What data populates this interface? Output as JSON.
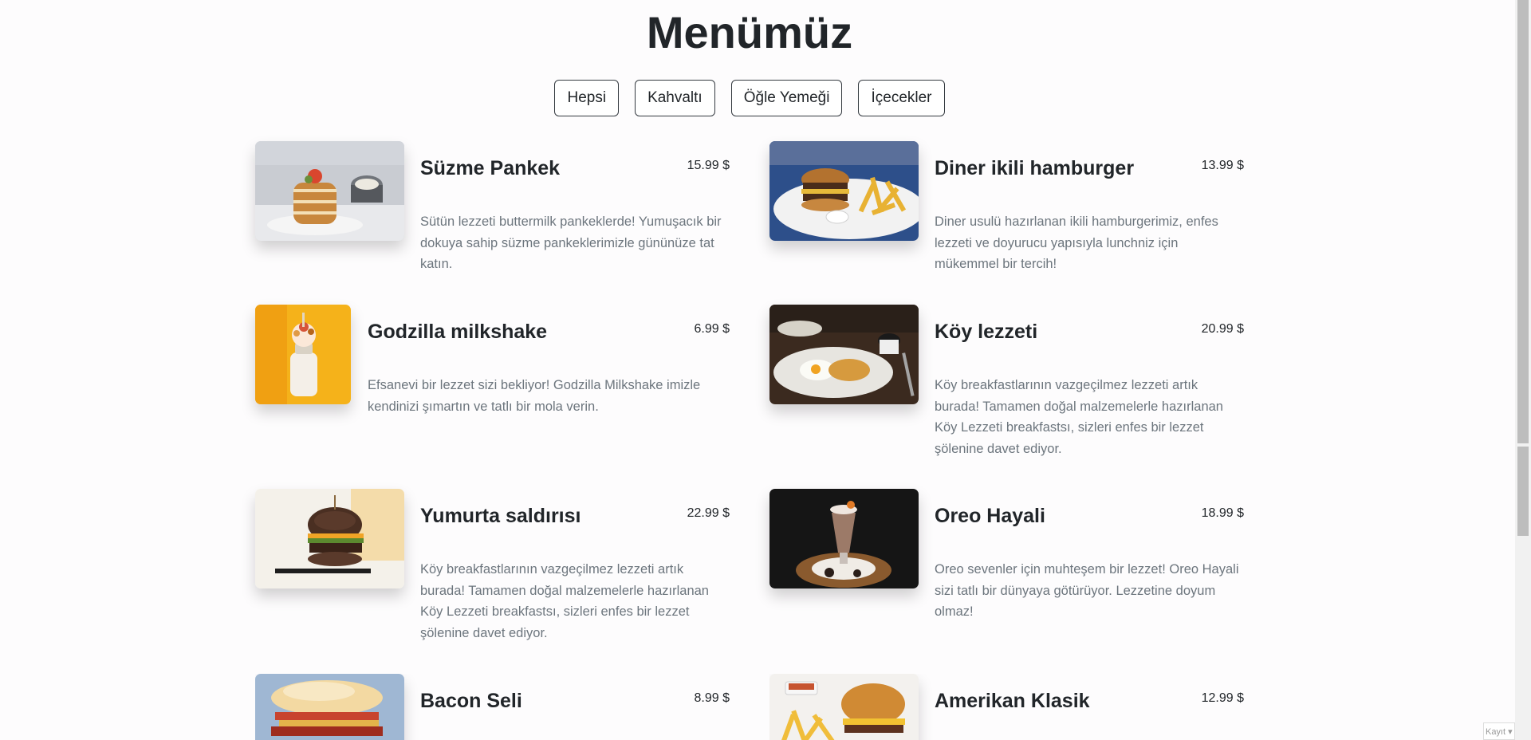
{
  "page": {
    "title": "Menümüz"
  },
  "filters": [
    "Hepsi",
    "Kahvaltı",
    "Öğle Yemeği",
    "İçecekler"
  ],
  "items": [
    {
      "name": "Süzme Pankek",
      "price": "15.99 $",
      "desc": "Sütün lezzeti buttermilk pankeklerde! Yumuşacık bir dokuya sahip süzme pankeklerimizle gününüze tat katın.",
      "image": "pancake-photo"
    },
    {
      "name": "Diner ikili hamburger",
      "price": "13.99 $",
      "desc": "Diner usulü hazırlanan ikili hamburgerimiz, enfes lezzeti ve doyurucu yapısıyla lunchniz için mükemmel bir tercih!",
      "image": "burger-fries-photo"
    },
    {
      "name": "Godzilla milkshake",
      "price": "6.99 $",
      "desc": "Efsanevi bir lezzet sizi bekliyor! Godzilla Milkshake imizle kendinizi şımartın ve tatlı bir mola verin.",
      "image": "milkshake-photo"
    },
    {
      "name": "Köy lezzeti",
      "price": "20.99 $",
      "desc": "Köy breakfastlarının vazgeçilmez lezzeti artık burada! Tamamen doğal malzemelerle hazırlanan Köy Lezzeti breakfastsı, sizleri enfes bir lezzet şölenine davet ediyor.",
      "image": "breakfast-plate-photo"
    },
    {
      "name": "Yumurta saldırısı",
      "price": "22.99 $",
      "desc": "Köy breakfastlarının vazgeçilmez lezzeti artık burada! Tamamen doğal malzemelerle hazırlanan Köy Lezzeti breakfastsı, sizleri enfes bir lezzet şölenine davet ediyor.",
      "image": "egg-burger-photo"
    },
    {
      "name": "Oreo Hayali",
      "price": "18.99 $",
      "desc": "Oreo sevenler için muhteşem bir lezzet! Oreo Hayali sizi tatlı bir dünyaya götürüyor. Lezzetine doyum olmaz!",
      "image": "oreo-shake-photo"
    },
    {
      "name": "Bacon Seli",
      "price": "8.99 $",
      "desc": "",
      "image": "bacon-sandwich-photo"
    },
    {
      "name": "Amerikan Klasik",
      "price": "12.99 $",
      "desc": "",
      "image": "classic-burger-photo"
    }
  ],
  "corner_widget": {
    "label": "Kayıt"
  }
}
